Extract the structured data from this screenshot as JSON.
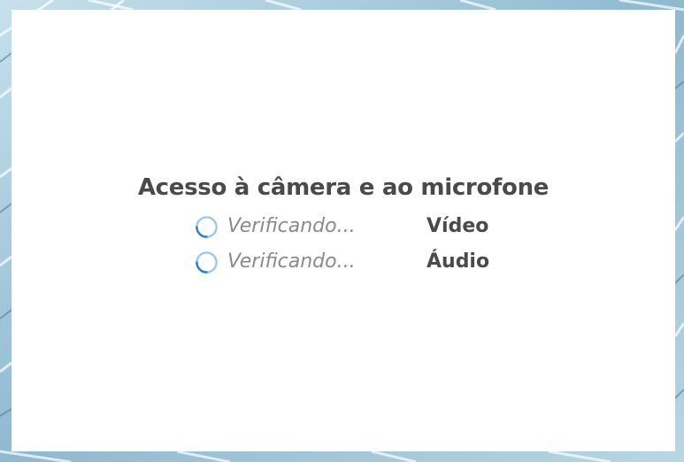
{
  "dialog": {
    "title": "Acesso à câmera e ao microfone",
    "checks": [
      {
        "status": "Verificando...",
        "label": "Vídeo"
      },
      {
        "status": "Verificando...",
        "label": "Áudio"
      }
    ]
  },
  "colors": {
    "spinner_track": "#9fc8e6",
    "spinner_arc": "#2b7fc4",
    "title_text": "#4a4a4a",
    "status_text": "#8a8a8a"
  },
  "icons": {
    "spinner": "loading-spinner-icon"
  }
}
